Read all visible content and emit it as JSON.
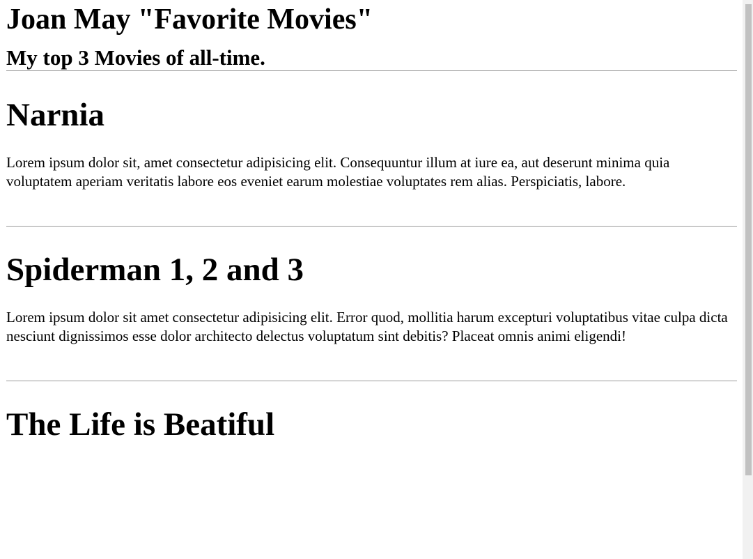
{
  "header": {
    "title": "Joan May \"Favorite Movies\"",
    "subtitle": "My top 3 Movies of all-time."
  },
  "movies": [
    {
      "title": "Narnia",
      "description": "Lorem ipsum dolor sit, amet consectetur adipisicing elit. Consequuntur illum at iure ea, aut deserunt minima quia voluptatem aperiam veritatis labore eos eveniet earum molestiae voluptates rem alias. Perspiciatis, labore."
    },
    {
      "title": "Spiderman 1, 2 and 3",
      "description": "Lorem ipsum dolor sit amet consectetur adipisicing elit. Error quod, mollitia harum excepturi voluptatibus vitae culpa dicta nesciunt dignissimos esse dolor architecto delectus voluptatum sint debitis? Placeat omnis animi eligendi!"
    },
    {
      "title": "The Life is Beatiful"
    }
  ]
}
